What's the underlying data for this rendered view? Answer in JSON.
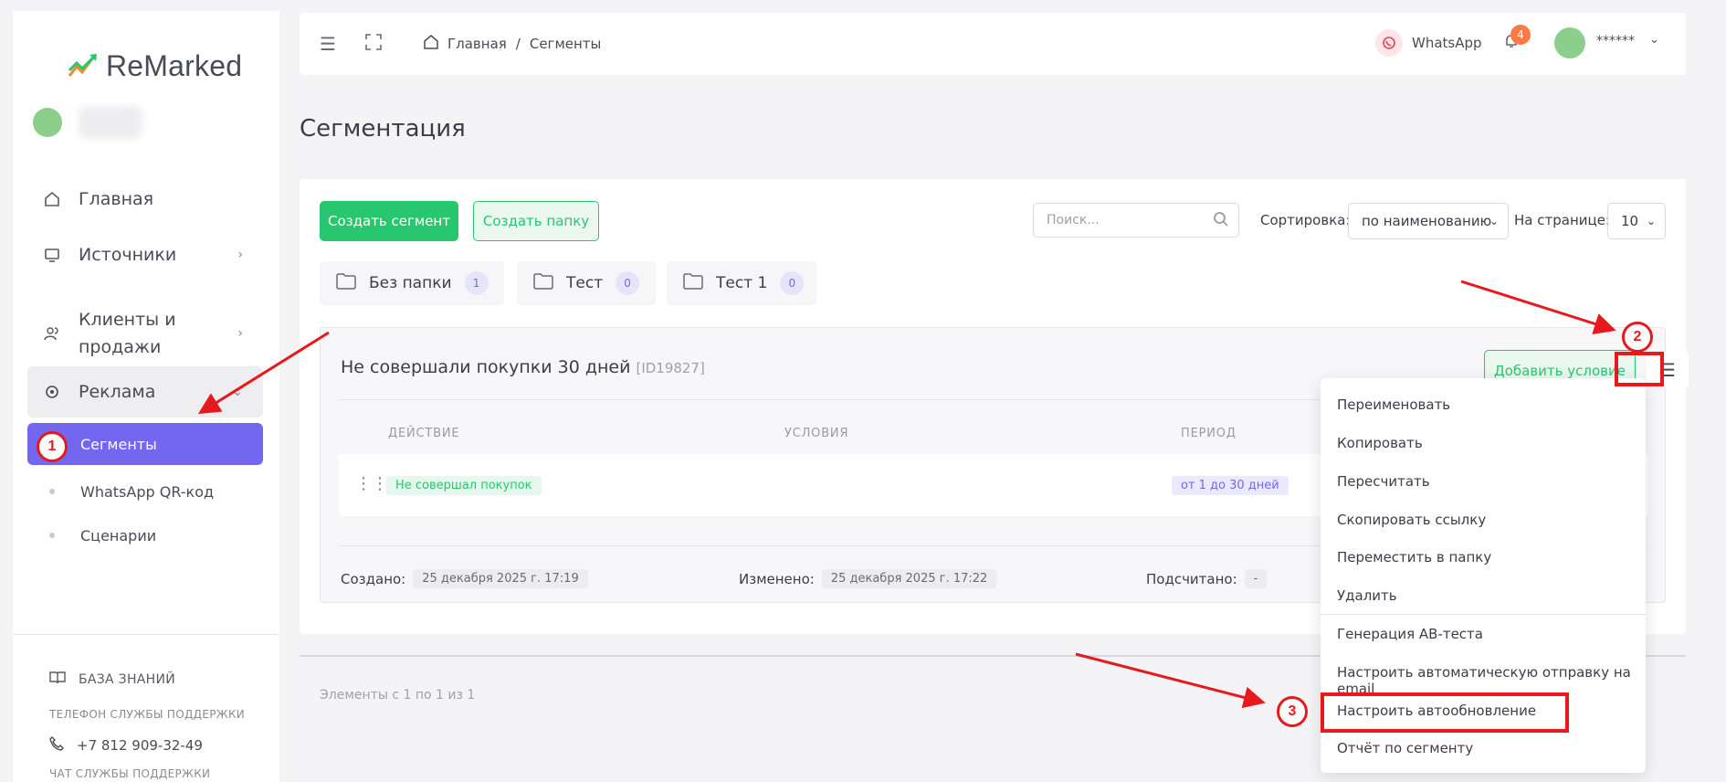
{
  "app": {
    "logo_text": "ReMarked"
  },
  "sidebar": {
    "items": [
      {
        "label": "Главная",
        "icon": "home-icon"
      },
      {
        "label": "Источники",
        "icon": "monitor-icon"
      },
      {
        "label": "Клиенты и",
        "label2": "продажи",
        "icon": "users-icon"
      },
      {
        "label": "Реклама",
        "icon": "target-icon"
      }
    ],
    "active_item": "Сегменты",
    "sub_items": [
      "WhatsApp QR-код",
      "Сценарии"
    ],
    "knowledge_base": "БАЗА ЗНАНИЙ",
    "support_phone_label": "ТЕЛЕФОН СЛУЖБЫ ПОДДЕРЖКИ",
    "support_phone": "+7 812 909-32-49",
    "support_chat_label": "ЧАТ СЛУЖБЫ ПОДДЕРЖКИ"
  },
  "header": {
    "breadcrumb_home": "Главная",
    "breadcrumb_sep": "/",
    "breadcrumb_current": "Сегменты",
    "whatsapp_label": "WhatsApp",
    "notifications_count": "4",
    "user_name": "******"
  },
  "page": {
    "title": "Сегментация"
  },
  "toolbar": {
    "create_segment": "Создать сегмент",
    "create_folder": "Создать папку",
    "search_placeholder": "Поиск...",
    "sort_label": "Сортировка:",
    "sort_value": "по наименованию",
    "per_page_label": "На странице:",
    "per_page_value": "10"
  },
  "folders": [
    {
      "name": "Без папки",
      "count": "1"
    },
    {
      "name": "Тест",
      "count": "0"
    },
    {
      "name": "Тест 1",
      "count": "0"
    }
  ],
  "segment": {
    "title": "Не совершали покупки 30 дней",
    "id": "[ID19827]",
    "add_condition": "Добавить условие",
    "columns": [
      "ДЕЙСТВИЕ",
      "УСЛОВИЯ",
      "ПЕРИОД"
    ],
    "row": {
      "action": "Не совершал покупок",
      "period": "от 1 до 30 дней"
    },
    "created_label": "Создано:",
    "created_value": "25 декабря 2025 г. 17:19",
    "modified_label": "Изменено:",
    "modified_value": "25 декабря 2025 г. 17:22",
    "counted_label": "Подсчитано:",
    "counted_value": "-"
  },
  "footer": {
    "text": "Элементы с 1 по 1 из 1"
  },
  "dropdown": {
    "items": [
      "Переименовать",
      "Копировать",
      "Пересчитать",
      "Скопировать ссылку",
      "Переместить в папку",
      "Удалить",
      "Генерация AB-теста",
      "Настроить автоматическую отправку на email",
      "Настроить автообновление",
      "Отчёт по сегменту"
    ]
  },
  "annotations": {
    "step1": "1",
    "step2": "2",
    "step3": "3"
  },
  "colors": {
    "accent": "#7367f0",
    "success": "#28c76f",
    "annotation": "#e8191c",
    "badge": "#ff7a45"
  }
}
